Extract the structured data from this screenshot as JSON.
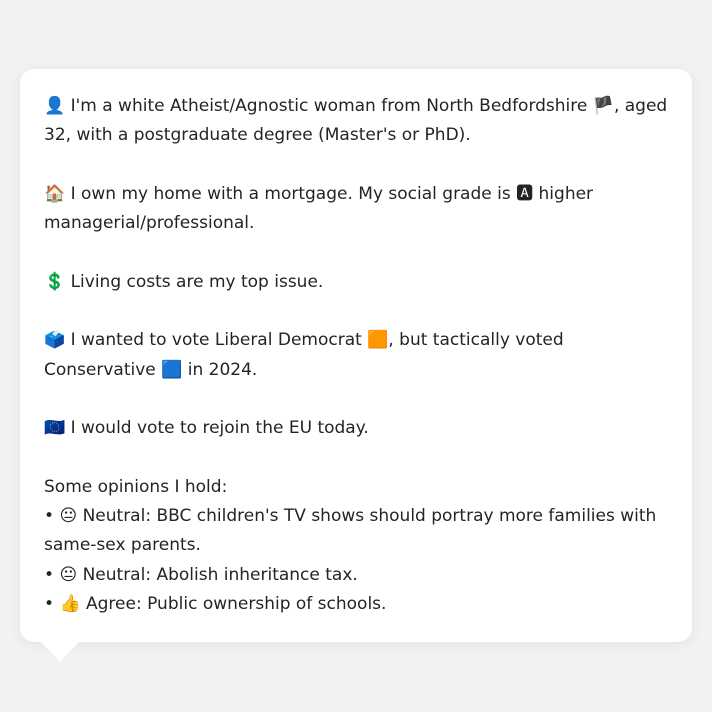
{
  "profile": {
    "identity": {
      "icon": "👤",
      "text_a": "I'm a white Atheist/Agnostic woman from North Bedfordshire",
      "flag": "🏴",
      "text_b": ", aged 32, with a postgraduate degree (Master's or PhD)."
    },
    "home": {
      "icon": "🏠",
      "text_a": "I own my home with a mortgage. My social grade is",
      "grade_badge": "🅰",
      "text_b": "higher managerial/professional."
    },
    "issue": {
      "icon": "💲",
      "text": "Living costs are my top issue."
    },
    "vote": {
      "icon": "🗳️",
      "text_a": "I wanted to vote Liberal Democrat",
      "libdem_square": "🟧",
      "text_b": ", but tactically voted Conservative",
      "con_square": "🟦",
      "text_c": "in 2024."
    },
    "eu": {
      "icon": "🇪🇺",
      "text": "I would vote to rejoin the EU today."
    },
    "opinions": {
      "heading": "Some opinions I hold:",
      "items": [
        {
          "bullet": "•",
          "icon": "😐",
          "text": "Neutral: BBC children's TV shows should portray more families with same-sex parents."
        },
        {
          "bullet": "•",
          "icon": "😐",
          "text": "Neutral: Abolish inheritance tax."
        },
        {
          "bullet": "•",
          "icon": "👍",
          "text": "Agree: Public ownership of schools."
        }
      ]
    }
  },
  "colors": {
    "page_background": "#f1f2f4",
    "bubble_background": "#ffffff",
    "text": "#212529"
  }
}
